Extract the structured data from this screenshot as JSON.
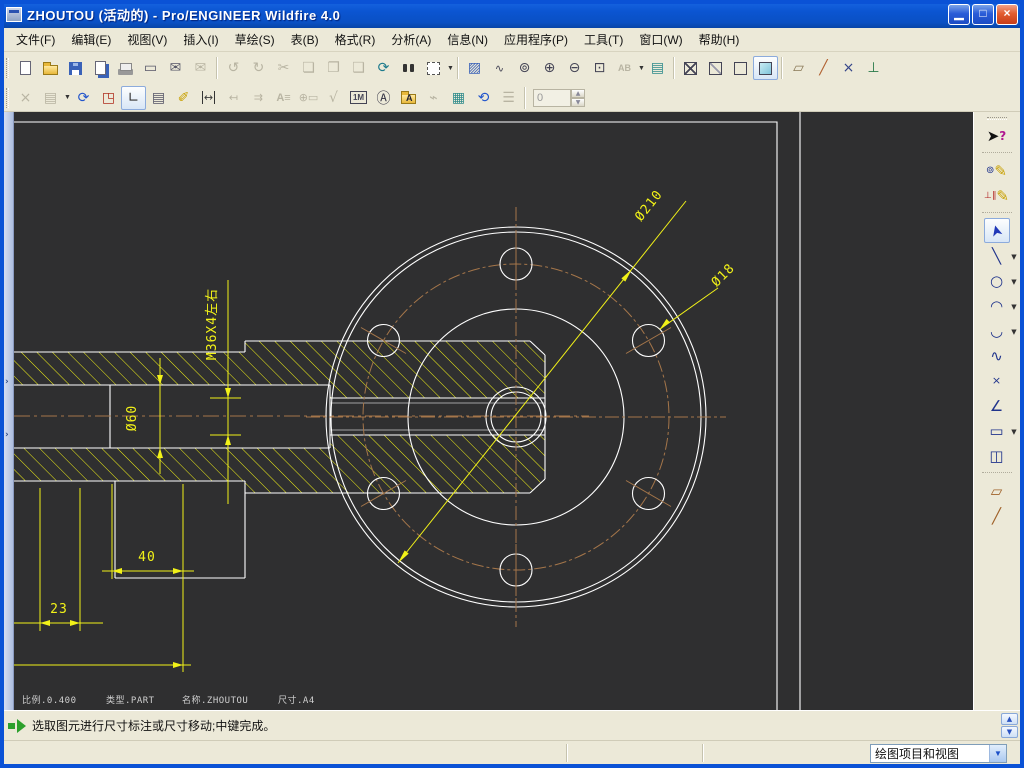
{
  "window": {
    "title": "ZHOUTOU (活动的) - Pro/ENGINEER Wildfire 4.0",
    "controls": [
      "minimize",
      "maximize",
      "close"
    ]
  },
  "menu": {
    "items": [
      "文件(F)",
      "编辑(E)",
      "视图(V)",
      "插入(I)",
      "草绘(S)",
      "表(B)",
      "格式(R)",
      "分析(A)",
      "信息(N)",
      "应用程序(P)",
      "工具(T)",
      "窗口(W)",
      "帮助(H)"
    ]
  },
  "toolbar_row1": {
    "icons": [
      "new-file",
      "open-file",
      "save",
      "save-a-copy",
      "print",
      "erase-display",
      "send-mail",
      "mail-link",
      "undo",
      "redo",
      "cut",
      "copy",
      "paste",
      "paste-special",
      "regenerate",
      "find",
      "selection-buffer",
      "repaint",
      "spin-center",
      "reorient-view",
      "zoom-in",
      "zoom-out",
      "refit",
      "rename",
      "layers",
      "wireframe-display",
      "hidden-line-display",
      "no-hidden-display",
      "shaded-display",
      "datum-plane-display",
      "datum-axis-display",
      "point-display",
      "csys-display"
    ]
  },
  "toolbar_row2": {
    "icons": [
      "delete",
      "group-list",
      "update-sheets",
      "insert-sheet",
      "lock-view-movement",
      "insert-table",
      "edit-annotations",
      "insert-dimension",
      "insert-ref-dimension",
      "insert-ordinate-dimension",
      "insert-note",
      "insert-gtol",
      "surface-finish",
      "dimension-text",
      "insert-balloon",
      "symbol-gallery",
      "custom-symbol",
      "table-grid",
      "update-tables",
      "table-properties"
    ],
    "spinner_value": "0"
  },
  "right_toolbar": {
    "icons": [
      "context-help",
      "sketch-references",
      "sketch-constraints",
      "select",
      "line-tool",
      "circle-tool",
      "arc-tool",
      "fillet-tool",
      "spline-tool",
      "point-tool",
      "chamfer-tool",
      "rect-tool",
      "use-edge-tool",
      "xsec-region",
      "xsec-line"
    ]
  },
  "drawing": {
    "dimensions": {
      "outer_dia": "Ø210",
      "hole_dia": "Ø18",
      "bore_dia": "Ø60",
      "thread": "M36X4左右",
      "length_40": "40",
      "length_23": "23"
    },
    "sheet_footer": {
      "scale": "比例.0.400",
      "type": "类型.PART",
      "name": "名称.ZHOUTOU",
      "size": "尺寸.A4"
    }
  },
  "status": {
    "message": "选取图元进行尺寸标注或尺寸移动;中键完成。",
    "selector_value": "绘图项目和视图"
  },
  "colors": {
    "window-border": "#0a52d6",
    "chrome": "#ece9d8",
    "canvas-bg": "#2f2f30",
    "draw-white": "#ffffff",
    "dim-yellow": "#f2f218",
    "centerline-brown": "#a5764a"
  }
}
